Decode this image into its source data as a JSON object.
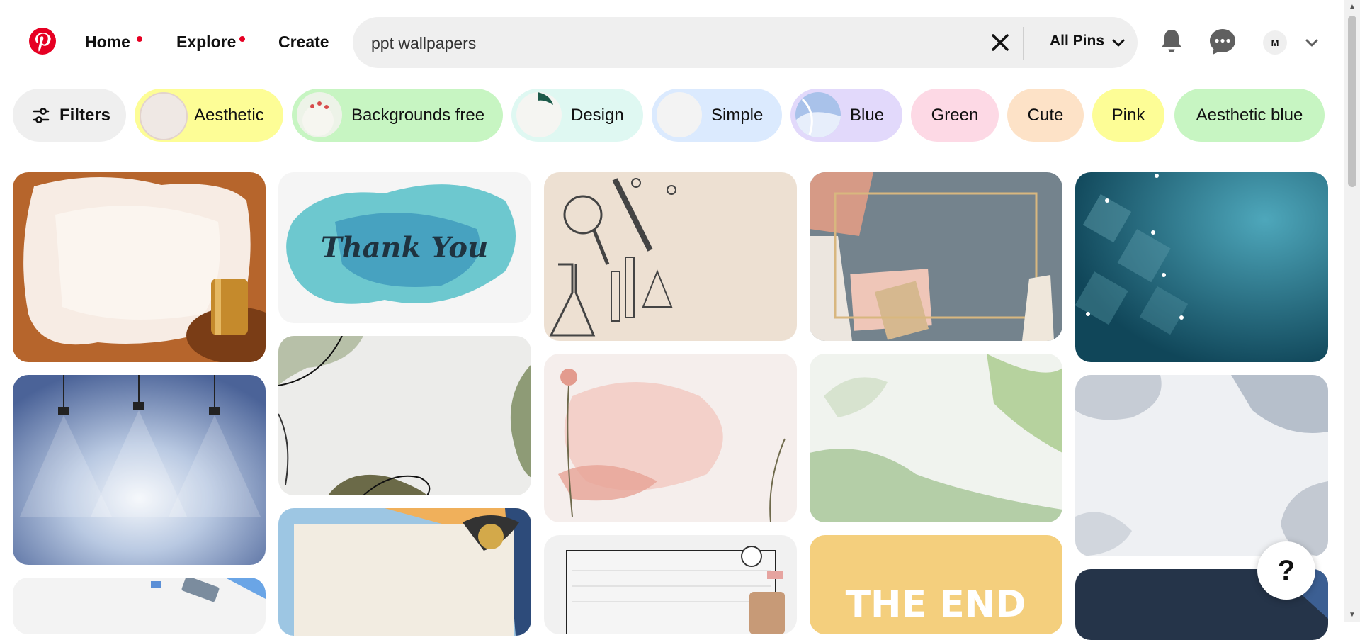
{
  "header": {
    "nav": {
      "home": "Home",
      "explore": "Explore",
      "create": "Create"
    },
    "search": {
      "value": "ppt wallpapers",
      "scope": "All Pins"
    },
    "avatar_initial": "M",
    "accent_color": "#e60023"
  },
  "filters": {
    "filters_label": "Filters",
    "chips": [
      {
        "label": "Aesthetic",
        "color": "#fdfd96"
      },
      {
        "label": "Backgrounds free",
        "color": "#c7f5c2"
      },
      {
        "label": "Design",
        "color": "#dff8f2"
      },
      {
        "label": "Simple",
        "color": "#dbeafe"
      },
      {
        "label": "Blue",
        "color": "#e2d9fb"
      },
      {
        "label": "Green",
        "color": "#fdd9e5"
      },
      {
        "label": "Cute",
        "color": "#fde2c7"
      },
      {
        "label": "Pink",
        "color": "#fdfd96"
      },
      {
        "label": "Aesthetic blue",
        "color": "#c7f5c2"
      }
    ]
  },
  "pins": {
    "thank_you_text": "Thank You",
    "the_end_text": "THE END"
  },
  "help": {
    "label": "?"
  }
}
